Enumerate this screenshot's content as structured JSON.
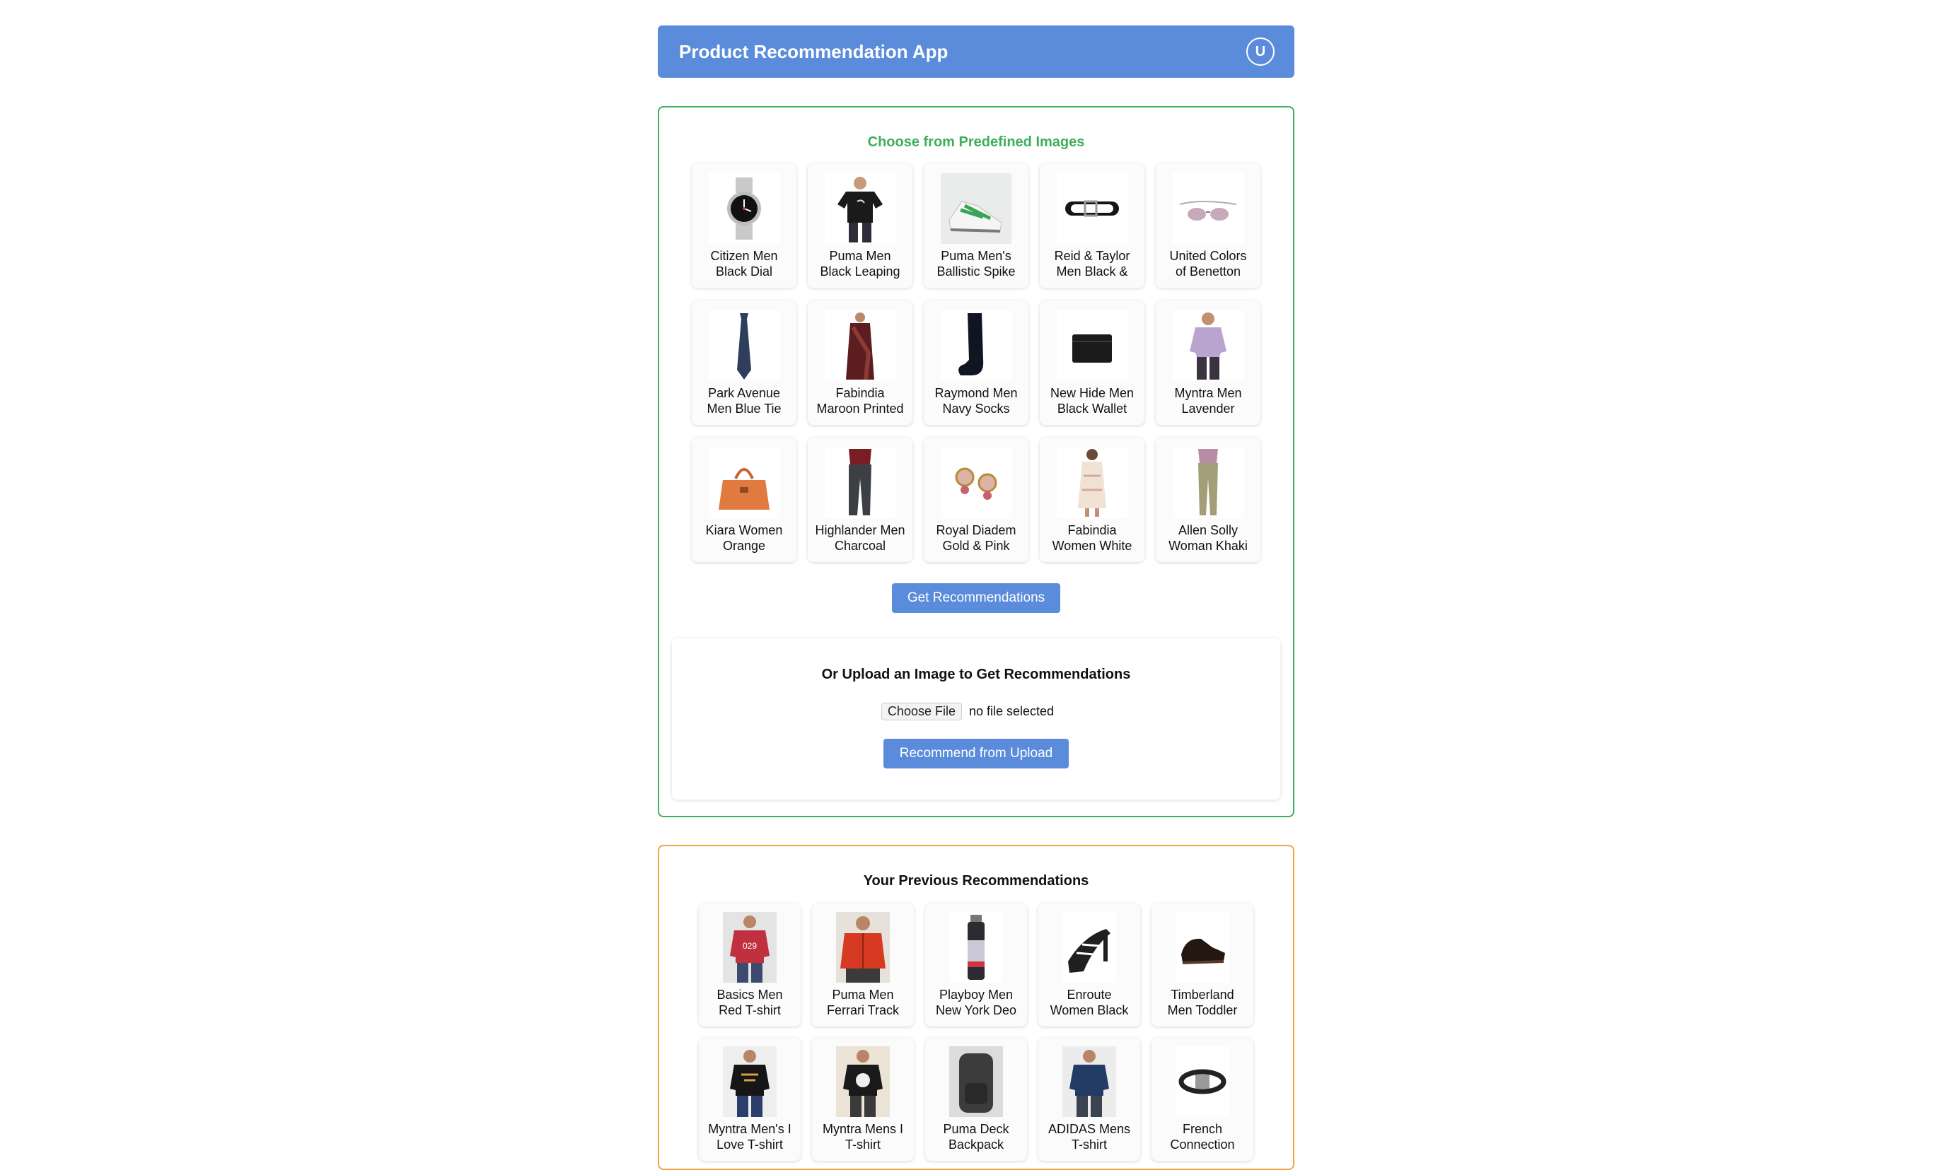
{
  "app": {
    "title": "Product Recommendation App",
    "avatar_letter": "U"
  },
  "predefined": {
    "title": "Choose from Predefined Images",
    "items": [
      {
        "label": "Citizen Men Black Dial Watch",
        "icon": "watch-image"
      },
      {
        "label": "Puma Men Black Leaping Cat T-shirt",
        "icon": "tshirt-image"
      },
      {
        "label": "Puma Men's Ballistic Spike White Green",
        "icon": "sneaker-image"
      },
      {
        "label": "Reid & Taylor Men Black & Brown",
        "icon": "belt-image"
      },
      {
        "label": "United Colors of Benetton Men Sunglasses",
        "icon": "sunglasses-image"
      },
      {
        "label": "Park Avenue Men Blue Tie",
        "icon": "tie-image"
      },
      {
        "label": "Fabindia Maroon Printed Nodal",
        "icon": "saree-image"
      },
      {
        "label": "Raymond Men Navy Socks",
        "icon": "socks-image"
      },
      {
        "label": "New Hide Men Black Wallet",
        "icon": "wallet-image"
      },
      {
        "label": "Myntra Men Lavender Striped Shirt",
        "icon": "shirt-image"
      },
      {
        "label": "Kiara Women Orange Handbag",
        "icon": "handbag-image"
      },
      {
        "label": "Highlander Men Charcoal Chinos",
        "icon": "trousers-image"
      },
      {
        "label": "Royal Diadem Gold & Pink Earrings",
        "icon": "earrings-image"
      },
      {
        "label": "Fabindia Women White Printed Kurta",
        "icon": "kurta-image"
      },
      {
        "label": "Allen Solly Woman Khaki Trousers",
        "icon": "khaki-trousers-image"
      }
    ],
    "button_label": "Get Recommendations"
  },
  "upload": {
    "title": "Or Upload an Image to Get Recommendations",
    "choose_label": "Choose File",
    "status": "no file selected",
    "button_label": "Recommend from Upload"
  },
  "previous": {
    "title": "Your Previous Recommendations",
    "items": [
      {
        "label": "Basics Men Red T-shirt",
        "icon": "red-tshirt-image"
      },
      {
        "label": "Puma Men Ferrari Track Jacket",
        "icon": "red-jacket-image"
      },
      {
        "label": "Playboy Men New York Deo",
        "icon": "deo-image"
      },
      {
        "label": "Enroute Women Black Sandals",
        "icon": "sandal-image"
      },
      {
        "label": "Timberland Men Toddler Shoes",
        "icon": "shoe-image"
      },
      {
        "label": "Myntra Men's I Love T-shirt",
        "icon": "black-tshirt-image"
      },
      {
        "label": "Myntra Mens I T-shirt",
        "icon": "skull-tshirt-image"
      },
      {
        "label": "Puma Deck Backpack",
        "icon": "backpack-image"
      },
      {
        "label": "ADIDAS Mens T-shirt",
        "icon": "navy-tshirt-image"
      },
      {
        "label": "French Connection Belt",
        "icon": "belt-buckle-image"
      }
    ]
  }
}
